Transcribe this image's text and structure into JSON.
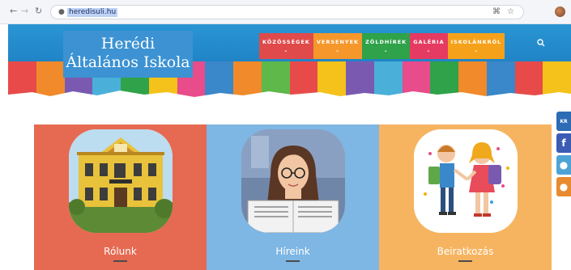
{
  "browser": {
    "back_icon": "back-arrow-icon",
    "forward_icon": "forward-arrow-icon",
    "reload_icon": "reload-icon",
    "url": "heredisuli.hu",
    "right_icons": [
      "translate-icon",
      "star-icon"
    ]
  },
  "site": {
    "title_line1": "Herédi",
    "title_line2": "Általános Iskola",
    "menu": [
      {
        "label": "KÖZÖSSÉGEK",
        "color": "#e04a4a"
      },
      {
        "label": "VERSENYEK",
        "color": "#f5972b"
      },
      {
        "label": "ZÖLDHÍREK",
        "color": "#2fa24a"
      },
      {
        "label": "GALÉRIA",
        "color": "#e53a61"
      },
      {
        "label": "ISKOLÁNKRÓL",
        "color": "#f6a11a"
      }
    ],
    "menu_caret": "⌄",
    "search_icon": "search-icon"
  },
  "cards": [
    {
      "label": "Rólunk",
      "color": "#e66a52",
      "image": "school-building-image"
    },
    {
      "label": "Híreink",
      "color": "#7eb6e4",
      "image": "woman-reading-newspaper-image"
    },
    {
      "label": "Beiratkozás",
      "color": "#f6b461",
      "image": "children-with-backpacks-image"
    }
  ],
  "social": [
    "kreta-icon",
    "facebook-icon",
    "other-icon",
    "other-icon"
  ]
}
